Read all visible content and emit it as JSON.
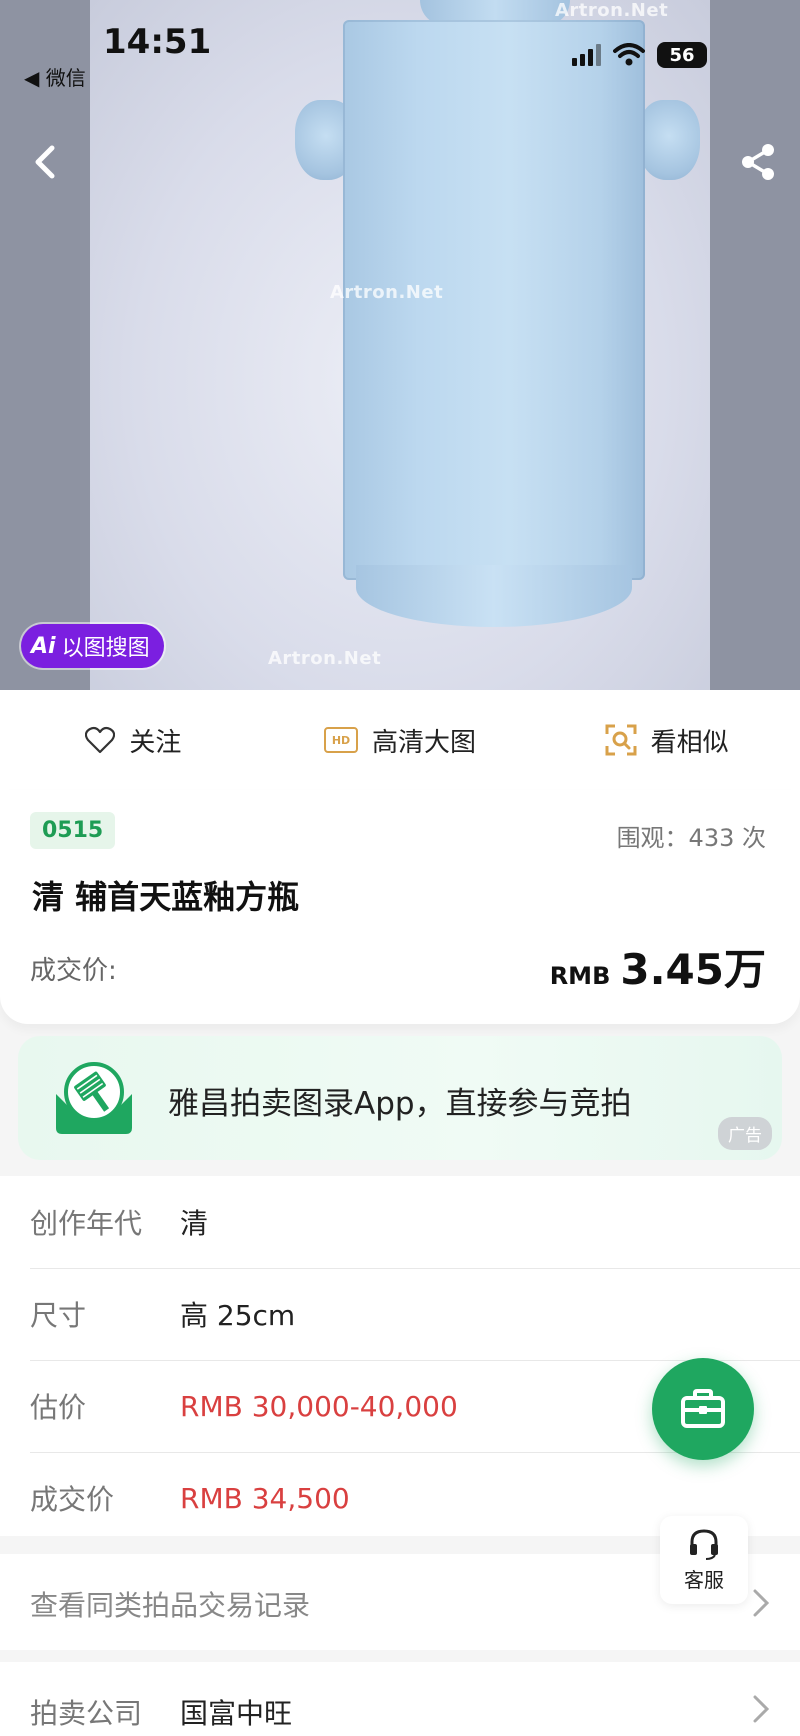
{
  "status_bar": {
    "time": "14:51",
    "back_app": "◀ 微信",
    "battery": "56"
  },
  "hero": {
    "watermark": "Artron.Net",
    "ai_search_logo": "Ai",
    "ai_search_label": "以图搜图"
  },
  "actions": [
    {
      "label": "关注",
      "icon": "heart-outline-icon"
    },
    {
      "label": "高清大图",
      "icon": "hd-icon",
      "icon_text": "HD"
    },
    {
      "label": "看相似",
      "icon": "similar-search-icon"
    }
  ],
  "lot": {
    "number": "0515",
    "views": "围观：433 次",
    "title": "清 辅首天蓝釉方瓶",
    "deal_label": "成交价:",
    "deal_currency": "RMB",
    "deal_amount": "3.45万"
  },
  "ad": {
    "text": "雅昌拍卖图录App，直接参与竞拍",
    "tag": "广告"
  },
  "details": {
    "era_label": "创作年代",
    "era_value": "清",
    "size_label": "尺寸",
    "size_value": "高 25cm",
    "estimate_label": "估价",
    "estimate_value": "RMB  30,000-40,000",
    "deal_label": "成交价",
    "deal_value": "RMB 34,500"
  },
  "service_label": "客服",
  "records_label": "查看同类拍品交易记录",
  "company": {
    "label": "拍卖公司",
    "value": "国富中旺"
  },
  "colors": {
    "brand_green": "#1fa760",
    "price_red": "#d94040",
    "ai_purple": "#7b1fe0",
    "hd_gold": "#d8a14a"
  }
}
